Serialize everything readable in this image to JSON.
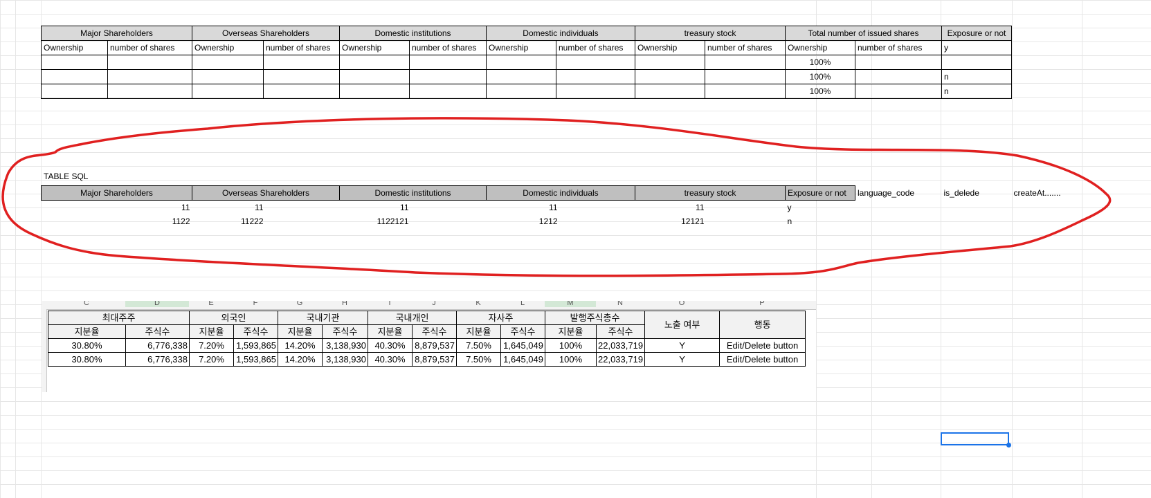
{
  "top_table": {
    "groups": [
      "Major Shareholders",
      "Overseas Shareholders",
      "Domestic institutions",
      "Domestic individuals",
      "treasury stock",
      "Total number of issued shares",
      "Exposure or not"
    ],
    "subheaders": [
      "Ownership",
      "number of shares",
      "Ownership",
      "number of shares",
      "Ownership",
      "number of shares",
      "Ownership",
      "number of shares",
      "Ownership",
      "number of shares",
      "Ownership",
      "number of shares",
      "y"
    ],
    "rows": [
      {
        "total_pct": "100%",
        "exposure": ""
      },
      {
        "total_pct": "100%",
        "exposure": "n"
      },
      {
        "total_pct": "100%",
        "exposure": "n"
      }
    ]
  },
  "sql_table": {
    "label": "TABLE SQL",
    "headers": [
      "Major Shareholders",
      "Overseas Shareholders",
      "Domestic institutions",
      "Domestic individuals",
      "treasury stock",
      "Exposure or not",
      "language_code",
      "is_delede",
      "createAt......."
    ],
    "rows": [
      [
        "11",
        "11",
        "11",
        "11",
        "11",
        "y"
      ],
      [
        "1122",
        "11222",
        "1122121",
        "1212",
        "12121",
        "n"
      ]
    ]
  },
  "korean_table": {
    "col_letters": [
      "C",
      "D",
      "E",
      "F",
      "G",
      "H",
      "I",
      "J",
      "K",
      "L",
      "M",
      "N",
      "O",
      "P"
    ],
    "groups": [
      "최대주주",
      "외국인",
      "국내기관",
      "국내개인",
      "자사주",
      "발행주식총수",
      "노출 여부",
      "행동"
    ],
    "sub": [
      "지분율",
      "주식수"
    ],
    "rows": [
      [
        "30.80%",
        "6,776,338",
        "7.20%",
        "1,593,865",
        "14.20%",
        "3,138,930",
        "40.30%",
        "8,879,537",
        "7.50%",
        "1,645,049",
        "100%",
        "22,033,719",
        "Y",
        "Edit/Delete button"
      ],
      [
        "30.80%",
        "6,776,338",
        "7.20%",
        "1,593,865",
        "14.20%",
        "3,138,930",
        "40.30%",
        "8,879,537",
        "7.50%",
        "1,645,049",
        "100%",
        "22,033,719",
        "Y",
        "Edit/Delete button"
      ]
    ]
  },
  "colors": {
    "annotation": "#e02020",
    "selection": "#1a73e8"
  }
}
